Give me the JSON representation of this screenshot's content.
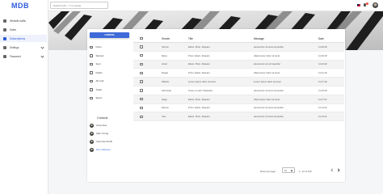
{
  "app": {
    "logo": "MDB"
  },
  "sidebar": {
    "items": [
      {
        "label": "Website traffic",
        "icon": "chart-icon",
        "active": false,
        "expandable": false
      },
      {
        "label": "Sales",
        "icon": "money-icon",
        "active": false,
        "expandable": false
      },
      {
        "label": "Subscriptions",
        "icon": "envelope-icon",
        "active": true,
        "expandable": false
      },
      {
        "label": "Settings",
        "icon": "gear-icon",
        "active": false,
        "expandable": true
      },
      {
        "label": "Password",
        "icon": "lock-icon",
        "active": false,
        "expandable": true
      }
    ]
  },
  "topbar": {
    "search_placeholder": "Search (ctrl + \"/\" to focus)",
    "notifications_count": "1",
    "accent": "#2e5bd8"
  },
  "mail": {
    "compose_label": "COMPOSE",
    "folders": [
      {
        "label": "Inbox",
        "icon": "inbox-icon"
      },
      {
        "label": "Starred",
        "icon": "star-icon"
      },
      {
        "label": "Sent",
        "icon": "send-icon"
      },
      {
        "label": "Drafts",
        "icon": "file-icon"
      },
      {
        "label": "All mail",
        "icon": "mail-icon"
      },
      {
        "label": "Trash",
        "icon": "trash-icon"
      },
      {
        "label": "Spam",
        "icon": "spam-icon"
      }
    ],
    "contacts_title": "Contacts",
    "contacts": [
      {
        "name": "Anna Doe",
        "active": false
      },
      {
        "name": "Alan Turing",
        "active": false
      },
      {
        "name": "Veronica Smith",
        "active": false
      },
      {
        "name": "Tom Johnson",
        "active": true
      }
    ],
    "columns": {
      "sender": "Sender",
      "title": "Title",
      "message": "Message",
      "date": "Date"
    },
    "rows": [
      {
        "sender": "Vernon",
        "title": "Etiam. Proin. Aliquam",
        "message": "elementum sit amet imperdiet",
        "date": "11.29.20"
      },
      {
        "sender": "Iliana",
        "title": "Proin. Etiam. Aliquam",
        "message": "ullamcorper dolor sit amet",
        "date": "11.26.20"
      },
      {
        "sender": "Arnal",
        "title": "Etiam. Proin. Aliquam",
        "message": "elementum ac at imperdiet",
        "date": "11.24.20"
      },
      {
        "sender": "Rogan",
        "title": "Proin. Etiam. Aliquam",
        "message": "ullamcorper dolor sit amet",
        "date": "11.21.20"
      },
      {
        "sender": "Walmio",
        "title": "Lorem ipsum dolor sit amet",
        "message": "Lorem ipsum dolor sit amet",
        "date": "11.17.20"
      },
      {
        "sender": "Harvinder",
        "title": "Fusce ut velit. Phasellus",
        "message": "elementum sit amet imperdiet",
        "date": "11.19.20"
      },
      {
        "sender": "Gage",
        "title": "Etiam. Proin. Aliquam",
        "message": "ullamcorper dolor sit amet",
        "date": "11.17.21"
      },
      {
        "sender": "Damon",
        "title": "Proin. Etiam. Aliquam",
        "message": "elementum sit amet imperdiet",
        "date": "11.14.21"
      },
      {
        "sender": "Ivan",
        "title": "Etiam. Proin. Aliquam",
        "message": "elementum sit amet imperdiet",
        "date": "11.13.21"
      }
    ],
    "pagination": {
      "rows_per_page_label": "Rows per page:",
      "rows_per_page_value": "10",
      "range_text": "1 - 10 of 100"
    }
  }
}
